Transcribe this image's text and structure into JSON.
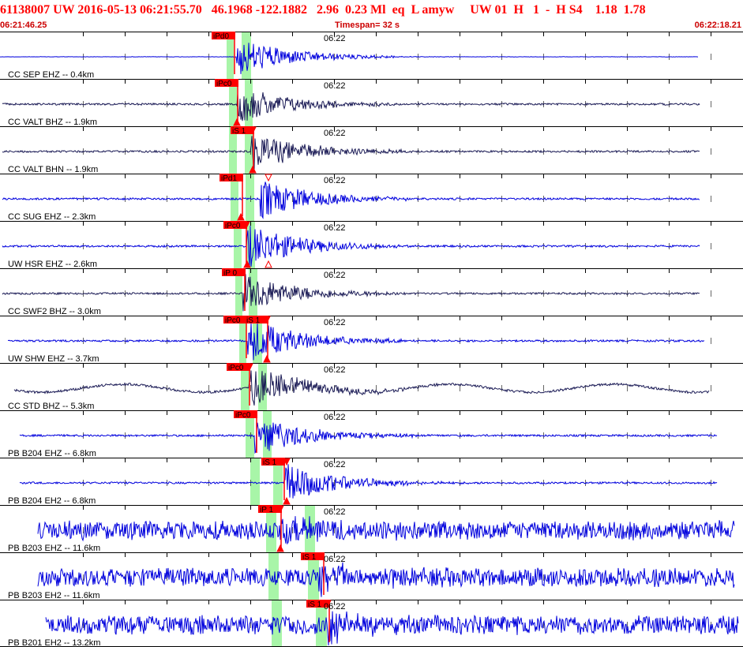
{
  "header": {
    "event_line": "61138007 UW 2016-05-13 06:21:55.70   46.1968 -122.1882   2.96  0.23 Ml  eq  L amyw     UW 01  H   1  -  H S4    1.18  1.78",
    "start_time": "06:21:46.25",
    "timespan": "Timespan=  32 s",
    "end_time": "06:22:18.21"
  },
  "time_tick_label": "06:22",
  "colors": {
    "header_text": "#ff0000",
    "trace_blue": "#0000dd",
    "trace_navy": "#1a1a55",
    "pick_flag": "#ff0000",
    "window_green": "#a8f5a8"
  },
  "traces": [
    {
      "label": "CC SEP EHZ -- 0.4km",
      "color": "trace_blue",
      "picks": [
        "iPd0"
      ],
      "wave": "quiet_then_burst"
    },
    {
      "label": "CC VALT BHZ -- 1.9km",
      "color": "trace_navy",
      "picks": [
        "iPc0"
      ],
      "wave": "burst"
    },
    {
      "label": "CC VALT BHN -- 1.9km",
      "color": "trace_navy",
      "picks": [
        "iS 1"
      ],
      "wave": "burst"
    },
    {
      "label": "CC SUG EHZ -- 2.3km",
      "color": "trace_blue",
      "picks": [
        "iPd1"
      ],
      "wave": "burst"
    },
    {
      "label": "UW HSR EHZ -- 2.6km",
      "color": "trace_blue",
      "picks": [
        "iPc0"
      ],
      "wave": "burst_strong"
    },
    {
      "label": "CC SWF2 BHZ -- 3.0km",
      "color": "trace_navy",
      "picks": [
        "iP 0"
      ],
      "wave": "burst"
    },
    {
      "label": "UW SHW EHZ -- 3.7km",
      "color": "trace_blue",
      "picks": [
        "iPc0",
        "iS 1"
      ],
      "wave": "burst_strong"
    },
    {
      "label": "CC STD BHZ -- 5.3km",
      "color": "trace_navy",
      "picks": [
        "iPc0"
      ],
      "wave": "longperiod"
    },
    {
      "label": "PB B204 EHZ -- 6.8km",
      "color": "trace_blue",
      "picks": [
        "iPc0"
      ],
      "wave": "burst"
    },
    {
      "label": "PB B204 EH2 -- 6.8km",
      "color": "trace_blue",
      "picks": [
        "iS 1"
      ],
      "wave": "burst"
    },
    {
      "label": "PB B203 EHZ -- 11.6km",
      "color": "trace_blue",
      "picks": [
        "iP 1"
      ],
      "wave": "noisy"
    },
    {
      "label": "PB B203 EH2 -- 11.6km",
      "color": "trace_blue",
      "picks": [
        "iS 1"
      ],
      "wave": "noisy"
    },
    {
      "label": "PB B201 EH2 -- 13.2km",
      "color": "trace_blue",
      "picks": [
        "iS 1"
      ],
      "wave": "noisy"
    }
  ]
}
